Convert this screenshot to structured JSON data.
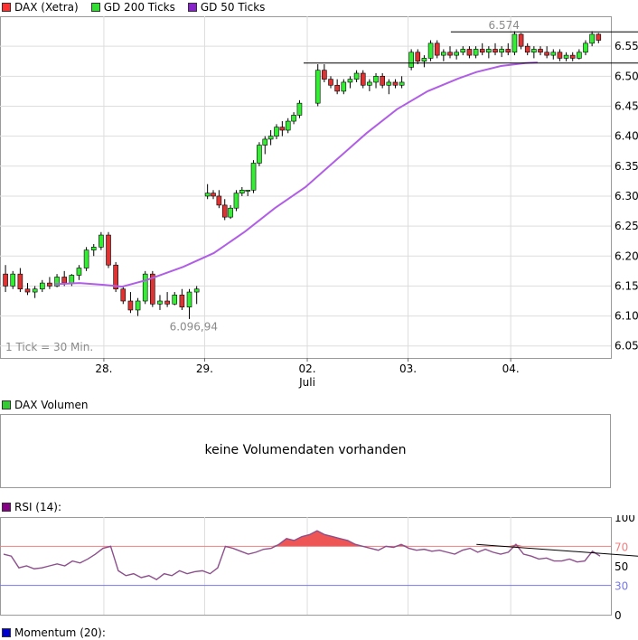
{
  "legend_main": [
    {
      "label": "DAX (Xetra)",
      "color": "#ff3030"
    },
    {
      "label": "GD 200 Ticks",
      "color": "#33dd33"
    },
    {
      "label": "GD 50 Ticks",
      "color": "#8822cc"
    }
  ],
  "legend_volume": {
    "label": "DAX Volumen",
    "color": "#33cc33"
  },
  "volume_notice": "keine Volumendaten vorhanden",
  "legend_rsi": {
    "label": "RSI (14):",
    "color": "#880088"
  },
  "legend_momentum": {
    "label": "Momentum (20):",
    "color": "#0000cc"
  },
  "colors": {
    "up": "#33ee33",
    "down": "#dd3333",
    "ma50": "#b15ee6",
    "rsi_line": "#8c4f8c",
    "rsi_fill": "#ee5555",
    "rsi_upper": "#f08080",
    "rsi_lower": "#7777ee",
    "grid": "#dddddd"
  },
  "chart_data": [
    {
      "type": "candlestick",
      "series_name": "DAX (Xetra)",
      "interval_note": "1 Tick = 30 Min.",
      "categories": [
        "28.",
        "29.",
        "02.",
        "03.",
        "04."
      ],
      "sub_label": "Juli",
      "y_ticks": [
        "6.05",
        "6.10",
        "6.15",
        "6.20",
        "6.25",
        "6.30",
        "6.35",
        "6.40",
        "6.45",
        "6.50",
        "6.55"
      ],
      "ylim": [
        6.03,
        6.6
      ],
      "annotations": {
        "high": "6.574",
        "low": "6.096,94"
      },
      "resistance_levels": [
        6.574,
        6.522
      ],
      "candles": [
        [
          6.17,
          6.185,
          6.14,
          6.15
        ],
        [
          6.15,
          6.175,
          6.145,
          6.17
        ],
        [
          6.17,
          6.18,
          6.14,
          6.145
        ],
        [
          6.145,
          6.155,
          6.135,
          6.14
        ],
        [
          6.14,
          6.15,
          6.13,
          6.145
        ],
        [
          6.145,
          6.16,
          6.14,
          6.155
        ],
        [
          6.155,
          6.165,
          6.145,
          6.15
        ],
        [
          6.15,
          6.17,
          6.148,
          6.165
        ],
        [
          6.165,
          6.175,
          6.15,
          6.155
        ],
        [
          6.155,
          6.17,
          6.15,
          6.168
        ],
        [
          6.168,
          6.185,
          6.16,
          6.18
        ],
        [
          6.18,
          6.215,
          6.175,
          6.21
        ],
        [
          6.21,
          6.22,
          6.2,
          6.215
        ],
        [
          6.215,
          6.24,
          6.21,
          6.235
        ],
        [
          6.235,
          6.24,
          6.18,
          6.185
        ],
        [
          6.185,
          6.19,
          6.14,
          6.145
        ],
        [
          6.145,
          6.15,
          6.12,
          6.125
        ],
        [
          6.125,
          6.14,
          6.105,
          6.11
        ],
        [
          6.11,
          6.13,
          6.1,
          6.125
        ],
        [
          6.125,
          6.175,
          6.12,
          6.17
        ],
        [
          6.17,
          6.175,
          6.115,
          6.12
        ],
        [
          6.12,
          6.135,
          6.11,
          6.125
        ],
        [
          6.125,
          6.14,
          6.115,
          6.12
        ],
        [
          6.12,
          6.14,
          6.118,
          6.135
        ],
        [
          6.135,
          6.145,
          6.11,
          6.115
        ],
        [
          6.115,
          6.145,
          6.095,
          6.14
        ],
        [
          6.14,
          6.15,
          6.12,
          6.145
        ],
        [
          6.3,
          6.32,
          6.295,
          6.305
        ],
        [
          6.305,
          6.31,
          6.295,
          6.3
        ],
        [
          6.3,
          6.31,
          6.28,
          6.285
        ],
        [
          6.285,
          6.295,
          6.26,
          6.265
        ],
        [
          6.265,
          6.285,
          6.262,
          6.28
        ],
        [
          6.28,
          6.31,
          6.275,
          6.305
        ],
        [
          6.305,
          6.315,
          6.3,
          6.31
        ],
        [
          6.31,
          6.31,
          6.3,
          6.31
        ],
        [
          6.31,
          6.36,
          6.305,
          6.355
        ],
        [
          6.355,
          6.39,
          6.35,
          6.385
        ],
        [
          6.385,
          6.4,
          6.37,
          6.395
        ],
        [
          6.395,
          6.41,
          6.385,
          6.4
        ],
        [
          6.4,
          6.42,
          6.395,
          6.415
        ],
        [
          6.415,
          6.425,
          6.4,
          6.41
        ],
        [
          6.41,
          6.43,
          6.405,
          6.425
        ],
        [
          6.425,
          6.44,
          6.42,
          6.435
        ],
        [
          6.435,
          6.46,
          6.43,
          6.455
        ],
        [
          6.455,
          6.52,
          6.45,
          6.51
        ],
        [
          6.51,
          6.52,
          6.49,
          6.495
        ],
        [
          6.495,
          6.5,
          6.48,
          6.485
        ],
        [
          6.485,
          6.495,
          6.47,
          6.475
        ],
        [
          6.475,
          6.495,
          6.47,
          6.49
        ],
        [
          6.49,
          6.5,
          6.48,
          6.495
        ],
        [
          6.495,
          6.51,
          6.49,
          6.505
        ],
        [
          6.505,
          6.51,
          6.48,
          6.485
        ],
        [
          6.485,
          6.495,
          6.475,
          6.49
        ],
        [
          6.49,
          6.505,
          6.48,
          6.5
        ],
        [
          6.5,
          6.505,
          6.48,
          6.485
        ],
        [
          6.485,
          6.495,
          6.47,
          6.49
        ],
        [
          6.49,
          6.495,
          6.48,
          6.485
        ],
        [
          6.485,
          6.5,
          6.48,
          6.49
        ],
        [
          6.515,
          6.545,
          6.51,
          6.54
        ],
        [
          6.54,
          6.545,
          6.52,
          6.525
        ],
        [
          6.525,
          6.535,
          6.515,
          6.53
        ],
        [
          6.53,
          6.56,
          6.525,
          6.555
        ],
        [
          6.555,
          6.56,
          6.53,
          6.535
        ],
        [
          6.535,
          6.545,
          6.525,
          6.54
        ],
        [
          6.54,
          6.55,
          6.53,
          6.535
        ],
        [
          6.535,
          6.545,
          6.528,
          6.54
        ],
        [
          6.54,
          6.55,
          6.535,
          6.545
        ],
        [
          6.545,
          6.55,
          6.53,
          6.535
        ],
        [
          6.535,
          6.55,
          6.53,
          6.545
        ],
        [
          6.545,
          6.555,
          6.535,
          6.54
        ],
        [
          6.54,
          6.55,
          6.53,
          6.545
        ],
        [
          6.545,
          6.555,
          6.535,
          6.54
        ],
        [
          6.54,
          6.55,
          6.532,
          6.545
        ],
        [
          6.545,
          6.555,
          6.535,
          6.54
        ],
        [
          6.54,
          6.575,
          6.535,
          6.57
        ],
        [
          6.57,
          6.572,
          6.545,
          6.55
        ],
        [
          6.55,
          6.555,
          6.535,
          6.54
        ],
        [
          6.54,
          6.55,
          6.53,
          6.545
        ],
        [
          6.545,
          6.55,
          6.535,
          6.54
        ],
        [
          6.54,
          6.55,
          6.53,
          6.535
        ],
        [
          6.535,
          6.545,
          6.528,
          6.54
        ],
        [
          6.54,
          6.545,
          6.525,
          6.53
        ],
        [
          6.53,
          6.54,
          6.525,
          6.535
        ],
        [
          6.535,
          6.54,
          6.525,
          6.53
        ],
        [
          6.53,
          6.545,
          6.528,
          6.54
        ],
        [
          6.54,
          6.56,
          6.535,
          6.555
        ],
        [
          6.555,
          6.575,
          6.55,
          6.57
        ],
        [
          6.57,
          6.572,
          6.555,
          6.56
        ]
      ],
      "ma50": [
        [
          0.09,
          6.153
        ],
        [
          0.13,
          6.155
        ],
        [
          0.17,
          6.152
        ],
        [
          0.2,
          6.149
        ],
        [
          0.24,
          6.16
        ],
        [
          0.3,
          6.182
        ],
        [
          0.35,
          6.205
        ],
        [
          0.4,
          6.24
        ],
        [
          0.45,
          6.28
        ],
        [
          0.5,
          6.315
        ],
        [
          0.55,
          6.36
        ],
        [
          0.6,
          6.405
        ],
        [
          0.65,
          6.445
        ],
        [
          0.7,
          6.475
        ],
        [
          0.75,
          6.496
        ],
        [
          0.78,
          6.507
        ],
        [
          0.82,
          6.517
        ],
        [
          0.86,
          6.522
        ],
        [
          0.88,
          6.523
        ]
      ]
    },
    {
      "type": "line",
      "series_name": "RSI (14)",
      "y_ticks": [
        "100",
        "70",
        "50",
        "30",
        "0"
      ],
      "ylim": [
        0,
        100
      ],
      "levels": [
        70,
        30
      ],
      "values": [
        62,
        60,
        48,
        50,
        47,
        48,
        50,
        52,
        50,
        55,
        53,
        57,
        62,
        68,
        70,
        45,
        40,
        42,
        38,
        40,
        36,
        42,
        40,
        45,
        42,
        44,
        45,
        42,
        48,
        70,
        68,
        65,
        62,
        64,
        67,
        68,
        72,
        78,
        76,
        80,
        82,
        86,
        82,
        80,
        78,
        76,
        72,
        70,
        68,
        66,
        70,
        69,
        72,
        68,
        66,
        67,
        65,
        66,
        64,
        62,
        66,
        68,
        64,
        67,
        64,
        62,
        64,
        72,
        62,
        60,
        57,
        58,
        55,
        55,
        57,
        54,
        55,
        65,
        60
      ]
    }
  ]
}
